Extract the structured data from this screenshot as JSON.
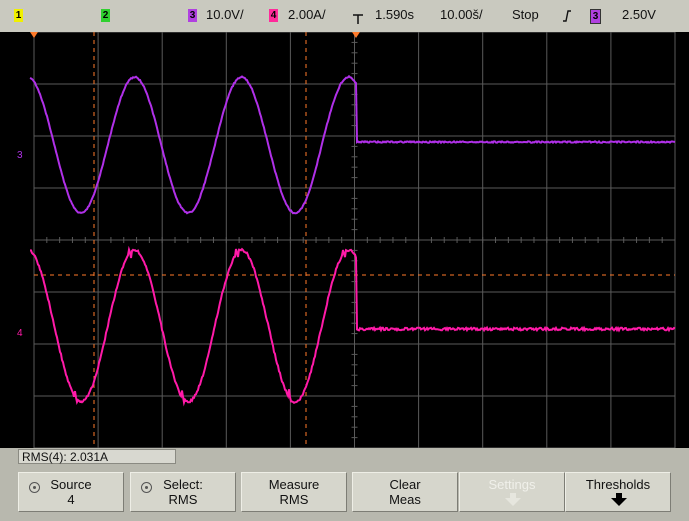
{
  "colors": {
    "ch1": "#f0f000",
    "ch2": "#2fd02f",
    "ch3": "#b040e0",
    "ch4": "#ff2a9a",
    "trace3": "#b030e8",
    "trace4": "#ff1aa8",
    "grid": "#5a5a5a",
    "marker": "#ff7a2a",
    "topbar_bg": "#c9c9bf"
  },
  "topbar": {
    "ch1_num": "1",
    "ch2_num": "2",
    "ch3_num": "3",
    "ch3_scale": "10.0V/",
    "ch4_num": "4",
    "ch4_scale": "2.00A/",
    "trig_delay": "1.590s",
    "time_scale": "10.00š/",
    "run_state": "Stop",
    "trig_slope_icon": "rising-edge-icon",
    "trig_src_num": "3",
    "trig_level": "2.50V"
  },
  "traces": {
    "ch3_label": "3",
    "ch4_label": "4"
  },
  "measurement": {
    "readout": "RMS(4): 2.031A"
  },
  "softkeys": [
    {
      "line1": "Source",
      "line2": "4",
      "icon": "knob-icon"
    },
    {
      "line1": "Select:",
      "line2": "RMS",
      "icon": "knob-icon"
    },
    {
      "line1": "Measure",
      "line2": "RMS"
    },
    {
      "line1": "Clear",
      "line2": "Meas"
    },
    {
      "line1": "Settings",
      "line2": "",
      "icon": "down-arrow-icon",
      "disabled": true
    },
    {
      "line1": "Thresholds",
      "line2": "",
      "icon": "down-arrow-icon"
    }
  ]
}
